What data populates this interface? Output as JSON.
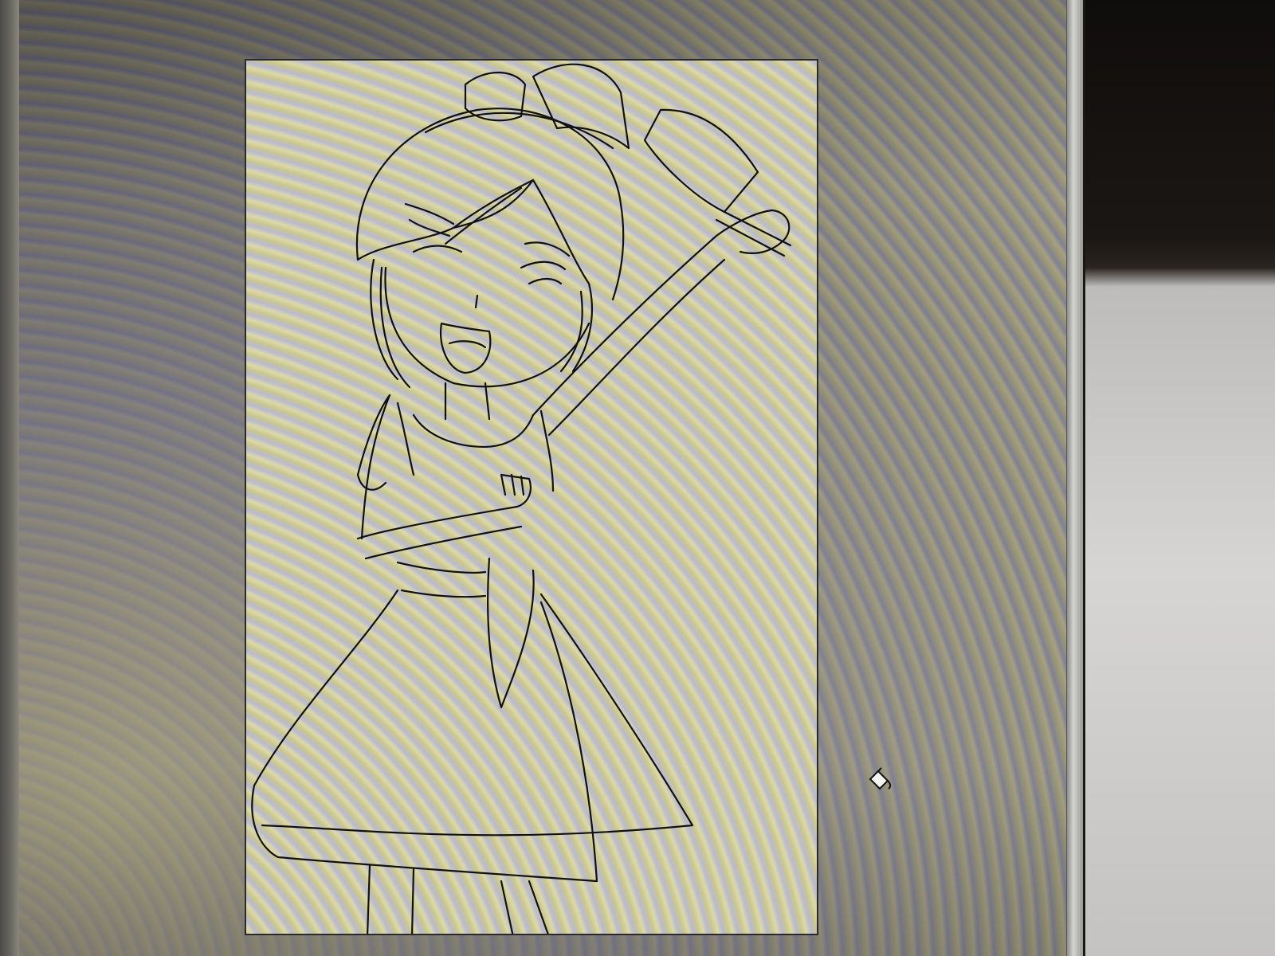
{
  "app": {
    "title": ""
  },
  "canvas": {
    "content": "line-art-drawing",
    "background_color": "#d4d3b2",
    "line_color": "#111111"
  },
  "cursor": {
    "tool": "paint-bucket-icon"
  },
  "icons": {
    "cursor": "paint-bucket-icon"
  }
}
